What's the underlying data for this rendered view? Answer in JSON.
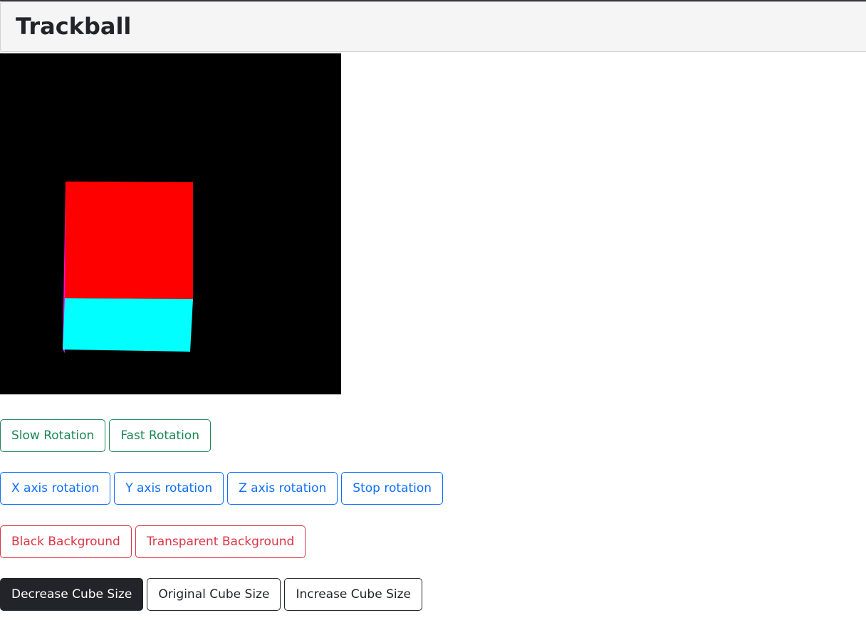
{
  "header": {
    "title": "Trackball"
  },
  "viewport": {
    "background": "#000000",
    "cube": {
      "front_face_color": "#ff0000",
      "bottom_face_color": "#00ffff",
      "side_face_color": "#ff00ff"
    }
  },
  "rotation_speed": {
    "slow_label": "Slow Rotation",
    "fast_label": "Fast Rotation",
    "color": "#198754"
  },
  "rotation_axis": {
    "x_label": "X axis rotation",
    "y_label": "Y axis rotation",
    "z_label": "Z axis rotation",
    "stop_label": "Stop rotation",
    "color": "#0d6efd"
  },
  "background_controls": {
    "black_label": "Black Background",
    "transparent_label": "Transparent Background",
    "color": "#dc3545"
  },
  "cube_size": {
    "decrease_label": "Decrease Cube Size",
    "original_label": "Original Cube Size",
    "increase_label": "Increase Cube Size",
    "selected": "Decrease Cube Size",
    "color": "#212529"
  }
}
